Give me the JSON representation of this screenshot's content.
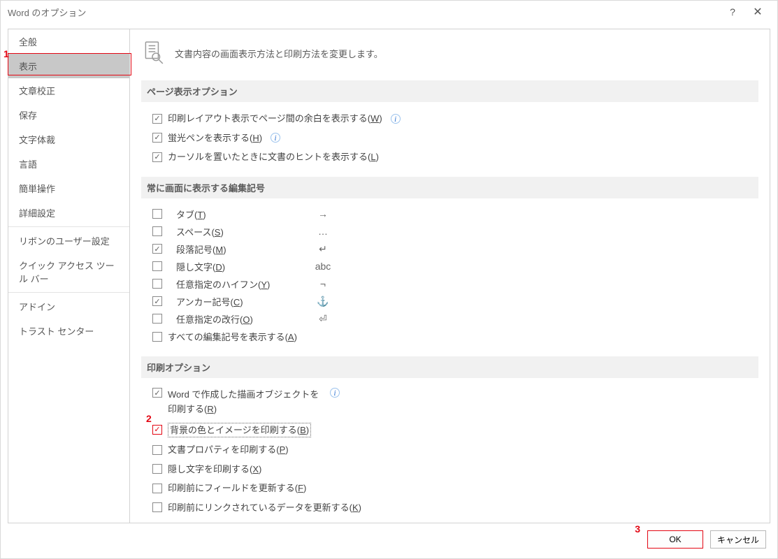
{
  "title": "Word のオプション",
  "header": "文書内容の画面表示方法と印刷方法を変更します。",
  "sidebar": {
    "items": [
      {
        "label": "全般"
      },
      {
        "label": "表示",
        "active": true
      },
      {
        "label": "文章校正"
      },
      {
        "label": "保存"
      },
      {
        "label": "文字体裁"
      },
      {
        "label": "言語"
      },
      {
        "label": "簡単操作"
      },
      {
        "label": "詳細設定"
      }
    ],
    "items2": [
      {
        "label": "リボンのユーザー設定"
      },
      {
        "label": "クイック アクセス ツール バー"
      }
    ],
    "items3": [
      {
        "label": "アドイン"
      },
      {
        "label": "トラスト センター"
      }
    ]
  },
  "sections": {
    "page": {
      "title": "ページ表示オプション",
      "opts": [
        {
          "label": "印刷レイアウト表示でページ間の余白を表示する(",
          "u": "W",
          "suffix": ")",
          "checked": true,
          "info": true
        },
        {
          "label": "蛍光ペンを表示する(",
          "u": "H",
          "suffix": ")",
          "checked": true,
          "info": true
        },
        {
          "label": "カーソルを置いたときに文書のヒントを表示する(",
          "u": "L",
          "suffix": ")",
          "checked": true
        }
      ]
    },
    "marks": {
      "title": "常に画面に表示する編集記号",
      "opts": [
        {
          "label": "タブ(",
          "u": "T",
          "suffix": ")",
          "checked": false,
          "sym": "→"
        },
        {
          "label": "スペース(",
          "u": "S",
          "suffix": ")",
          "checked": false,
          "sym": "…"
        },
        {
          "label": "段落記号(",
          "u": "M",
          "suffix": ")",
          "checked": true,
          "sym": "↵"
        },
        {
          "label": "隠し文字(",
          "u": "D",
          "suffix": ")",
          "checked": false,
          "sym": "abc"
        },
        {
          "label": "任意指定のハイフン(",
          "u": "Y",
          "suffix": ")",
          "checked": false,
          "sym": "¬"
        },
        {
          "label": "アンカー記号(",
          "u": "C",
          "suffix": ")",
          "checked": true,
          "sym": "⚓"
        },
        {
          "label": "任意指定の改行(",
          "u": "O",
          "suffix": ")",
          "checked": false,
          "sym": "⏎"
        }
      ],
      "all": {
        "label": "すべての編集記号を表示する(",
        "u": "A",
        "suffix": ")",
        "checked": false
      }
    },
    "print": {
      "title": "印刷オプション",
      "word_draw": {
        "label": "Word で作成した描画オブジェクトを印刷する(",
        "u": "R",
        "suffix": ")",
        "checked": true,
        "info": true
      },
      "opts": [
        {
          "label": "背景の色とイメージを印刷する(",
          "u": "B",
          "suffix": ")",
          "checked": true,
          "highlight": true
        },
        {
          "label": "文書プロパティを印刷する(",
          "u": "P",
          "suffix": ")",
          "checked": false
        },
        {
          "label": "隠し文字を印刷する(",
          "u": "X",
          "suffix": ")",
          "checked": false
        },
        {
          "label": "印刷前にフィールドを更新する(",
          "u": "F",
          "suffix": ")",
          "checked": false
        },
        {
          "label": "印刷前にリンクされているデータを更新する(",
          "u": "K",
          "suffix": ")",
          "checked": false
        }
      ]
    }
  },
  "footer": {
    "ok": "OK",
    "cancel": "キャンセル"
  },
  "annotations": {
    "one": "1",
    "two": "2",
    "three": "3"
  }
}
